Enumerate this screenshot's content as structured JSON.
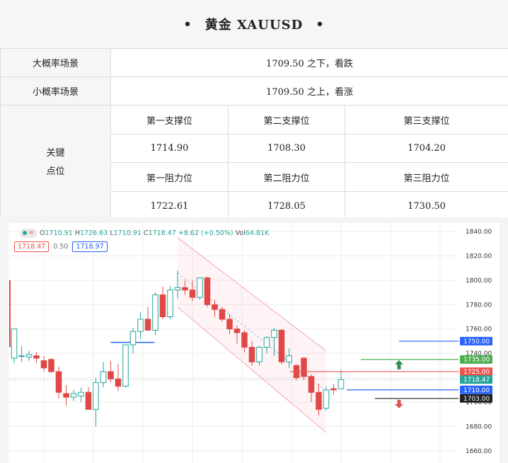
{
  "header": {
    "bullet_left": "•",
    "title": "黄金 XAUUSD",
    "bullet_right": "•"
  },
  "scenarios": [
    {
      "label": "大概率场景",
      "text": "1709.50 之下，看跌"
    },
    {
      "label": "小概率场景",
      "text": "1709.50 之上，看涨"
    }
  ],
  "key_levels": {
    "label_line1": "关键",
    "label_line2": "点位",
    "support_headers": [
      "第一支撑位",
      "第二支撑位",
      "第三支撑位"
    ],
    "support_values": [
      "1714.90",
      "1708.30",
      "1704.20"
    ],
    "resistance_headers": [
      "第一阻力位",
      "第二阻力位",
      "第三阻力位"
    ],
    "resistance_values": [
      "1722.61",
      "1728.05",
      "1730.50"
    ]
  },
  "chart_legend": {
    "open_label": "O",
    "open": "1710.91",
    "high_label": "H",
    "high": "1726.63",
    "low_label": "L",
    "low": "1710.91",
    "close_label": "C",
    "close": "1718.47",
    "change": "+8.62 (+0.50%)",
    "vol_label": "Vol",
    "volume": "64.81K",
    "bid": "1718.47",
    "spread": "0.50",
    "ask": "1718.97"
  },
  "chart_data": {
    "type": "candlestick",
    "symbol": "XAUUSD",
    "y_ticks": [
      "1840.00",
      "1820.00",
      "1800.00",
      "1780.00",
      "1760.00",
      "1740.00",
      "1720.00",
      "1700.00",
      "1680.00",
      "1660.00"
    ],
    "ylim": [
      1650,
      1847
    ],
    "candles": [
      {
        "o": 1736,
        "h": 1752,
        "l": 1732,
        "c": 1760
      },
      {
        "o": 1738,
        "h": 1746,
        "l": 1733,
        "c": 1738
      },
      {
        "o": 1737,
        "h": 1742,
        "l": 1734,
        "c": 1739
      },
      {
        "o": 1738,
        "h": 1741,
        "l": 1732,
        "c": 1736
      },
      {
        "o": 1734,
        "h": 1738,
        "l": 1725,
        "c": 1728
      },
      {
        "o": 1735,
        "h": 1736,
        "l": 1724,
        "c": 1725
      },
      {
        "o": 1725,
        "h": 1729,
        "l": 1703,
        "c": 1708
      },
      {
        "o": 1707,
        "h": 1714,
        "l": 1697,
        "c": 1704
      },
      {
        "o": 1704,
        "h": 1710,
        "l": 1701,
        "c": 1707
      },
      {
        "o": 1705,
        "h": 1712,
        "l": 1700,
        "c": 1708
      },
      {
        "o": 1708,
        "h": 1712,
        "l": 1694,
        "c": 1694
      },
      {
        "o": 1694,
        "h": 1720,
        "l": 1680,
        "c": 1716
      },
      {
        "o": 1716,
        "h": 1733,
        "l": 1712,
        "c": 1725
      },
      {
        "o": 1725,
        "h": 1734,
        "l": 1716,
        "c": 1719
      },
      {
        "o": 1719,
        "h": 1731,
        "l": 1709,
        "c": 1713
      },
      {
        "o": 1713,
        "h": 1744,
        "l": 1712,
        "c": 1747
      },
      {
        "o": 1747,
        "h": 1761,
        "l": 1740,
        "c": 1758
      },
      {
        "o": 1758,
        "h": 1774,
        "l": 1752,
        "c": 1768
      },
      {
        "o": 1768,
        "h": 1778,
        "l": 1762,
        "c": 1759
      },
      {
        "o": 1759,
        "h": 1790,
        "l": 1755,
        "c": 1788
      },
      {
        "o": 1788,
        "h": 1795,
        "l": 1768,
        "c": 1770
      },
      {
        "o": 1770,
        "h": 1795,
        "l": 1768,
        "c": 1792
      },
      {
        "o": 1792,
        "h": 1808,
        "l": 1785,
        "c": 1794
      },
      {
        "o": 1794,
        "h": 1800,
        "l": 1788,
        "c": 1792
      },
      {
        "o": 1792,
        "h": 1800,
        "l": 1783,
        "c": 1786
      },
      {
        "o": 1786,
        "h": 1802,
        "l": 1784,
        "c": 1802
      },
      {
        "o": 1802,
        "h": 1803,
        "l": 1778,
        "c": 1780
      },
      {
        "o": 1780,
        "h": 1784,
        "l": 1770,
        "c": 1776
      },
      {
        "o": 1776,
        "h": 1778,
        "l": 1766,
        "c": 1768
      },
      {
        "o": 1768,
        "h": 1772,
        "l": 1756,
        "c": 1760
      },
      {
        "o": 1760,
        "h": 1763,
        "l": 1748,
        "c": 1757
      },
      {
        "o": 1757,
        "h": 1759,
        "l": 1741,
        "c": 1745
      },
      {
        "o": 1745,
        "h": 1750,
        "l": 1730,
        "c": 1733
      },
      {
        "o": 1733,
        "h": 1746,
        "l": 1730,
        "c": 1745
      },
      {
        "o": 1745,
        "h": 1754,
        "l": 1740,
        "c": 1753
      },
      {
        "o": 1753,
        "h": 1761,
        "l": 1738,
        "c": 1759
      },
      {
        "o": 1759,
        "h": 1760,
        "l": 1731,
        "c": 1733
      },
      {
        "o": 1733,
        "h": 1744,
        "l": 1728,
        "c": 1738
      },
      {
        "o": 1730,
        "h": 1731,
        "l": 1718,
        "c": 1720
      },
      {
        "o": 1736,
        "h": 1737,
        "l": 1718,
        "c": 1721
      },
      {
        "o": 1721,
        "h": 1723,
        "l": 1700,
        "c": 1708
      },
      {
        "o": 1708,
        "h": 1715,
        "l": 1689,
        "c": 1694
      },
      {
        "o": 1695,
        "h": 1713,
        "l": 1693,
        "c": 1710
      },
      {
        "o": 1711,
        "h": 1715,
        "l": 1706,
        "c": 1710
      },
      {
        "o": 1710.91,
        "h": 1726.63,
        "l": 1710.91,
        "c": 1718.47
      }
    ],
    "horizontal_levels": [
      {
        "price": 1750.0,
        "label": "1750.00",
        "color": "#2962ff"
      },
      {
        "price": 1735.0,
        "label": "1735.00",
        "color": "#4caf50"
      },
      {
        "price": 1725.0,
        "label": "1725.00",
        "color": "#ef5350"
      },
      {
        "price": 1718.47,
        "label": "1718.47",
        "color": "#26a69a"
      },
      {
        "price": 1710.0,
        "label": "1710.00",
        "color": "#2962ff"
      },
      {
        "price": 1703.0,
        "label": "1703.00",
        "color": "#222222"
      }
    ],
    "colors": {
      "up": "#26a69a",
      "down": "#e04848",
      "channel": "#f4a6b8"
    }
  }
}
